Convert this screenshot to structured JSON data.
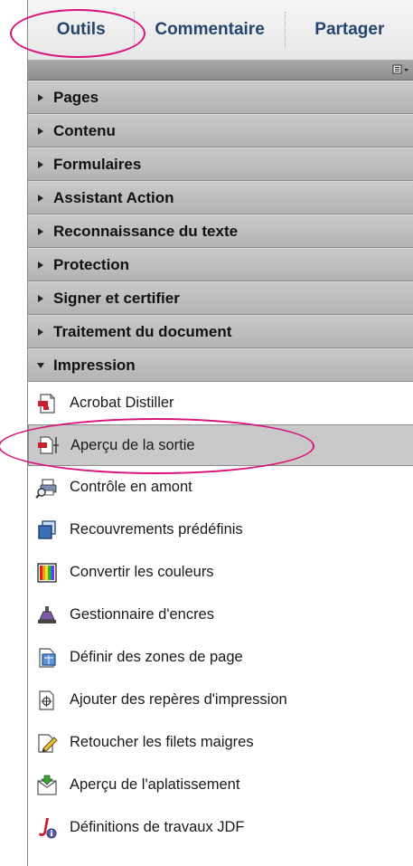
{
  "tabs": [
    {
      "label": "Outils"
    },
    {
      "label": "Commentaire"
    },
    {
      "label": "Partager"
    }
  ],
  "sections": [
    {
      "label": "Pages",
      "expanded": false
    },
    {
      "label": "Contenu",
      "expanded": false
    },
    {
      "label": "Formulaires",
      "expanded": false
    },
    {
      "label": "Assistant Action",
      "expanded": false
    },
    {
      "label": "Reconnaissance du texte",
      "expanded": false
    },
    {
      "label": "Protection",
      "expanded": false
    },
    {
      "label": "Signer et certifier",
      "expanded": false
    },
    {
      "label": "Traitement du document",
      "expanded": false
    },
    {
      "label": "Impression",
      "expanded": true
    }
  ],
  "impression_items": [
    {
      "label": "Acrobat Distiller",
      "icon": "acrobat-distiller-icon",
      "selected": false
    },
    {
      "label": "Aperçu de la sortie",
      "icon": "output-preview-icon",
      "selected": true
    },
    {
      "label": "Contrôle en amont",
      "icon": "preflight-icon",
      "selected": false
    },
    {
      "label": "Recouvrements prédéfinis",
      "icon": "trap-presets-icon",
      "selected": false
    },
    {
      "label": "Convertir les couleurs",
      "icon": "convert-colors-icon",
      "selected": false
    },
    {
      "label": "Gestionnaire d'encres",
      "icon": "ink-manager-icon",
      "selected": false
    },
    {
      "label": "Définir des zones de page",
      "icon": "page-boxes-icon",
      "selected": false
    },
    {
      "label": "Ajouter des repères d'impression",
      "icon": "printer-marks-icon",
      "selected": false
    },
    {
      "label": "Retoucher les filets maigres",
      "icon": "fix-hairlines-icon",
      "selected": false
    },
    {
      "label": "Aperçu de l'aplatissement",
      "icon": "flattener-preview-icon",
      "selected": false
    },
    {
      "label": "Définitions de travaux JDF",
      "icon": "jdf-job-definitions-icon",
      "selected": false
    }
  ],
  "colors": {
    "tab_text": "#24466e",
    "annotation": "#d8127a",
    "section_bg": "#bdbdbd",
    "selected_bg": "#c9c9c9"
  }
}
